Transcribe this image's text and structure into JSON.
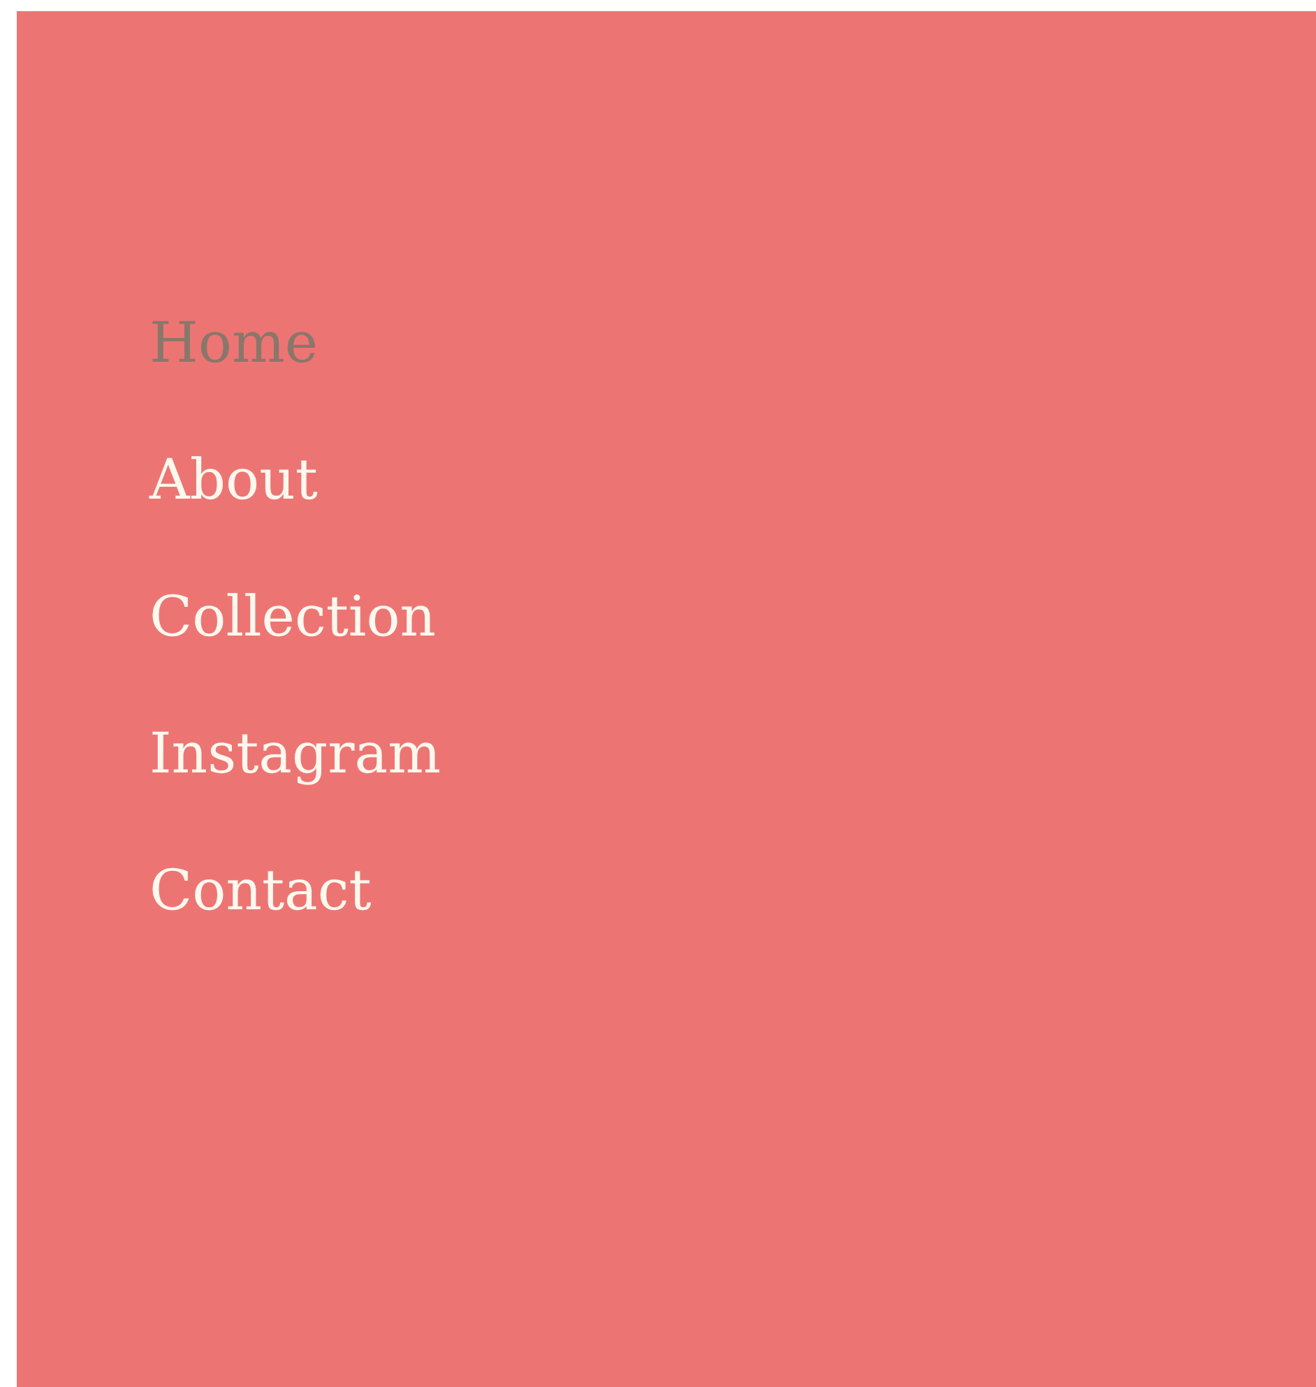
{
  "menu": {
    "items": [
      {
        "label": "Home",
        "selected": true
      },
      {
        "label": "About",
        "selected": false
      },
      {
        "label": "Collection",
        "selected": false
      },
      {
        "label": "Instagram",
        "selected": false
      },
      {
        "label": "Contact",
        "selected": false
      }
    ]
  }
}
